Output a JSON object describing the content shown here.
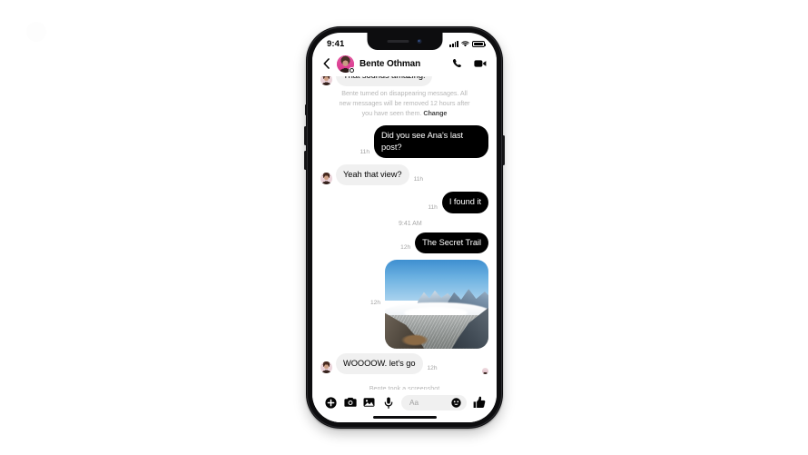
{
  "status_bar": {
    "time": "9:41",
    "signal_icon": "cellular-bars-icon",
    "wifi_icon": "wifi-icon",
    "battery_icon": "battery-full-icon"
  },
  "header": {
    "back_icon": "chevron-left-icon",
    "avatar_name": "avatar",
    "contact_name": "Bente Othman",
    "active_badge": "active-status-badge",
    "call_icon": "phone-call-icon",
    "video_icon": "video-camera-icon"
  },
  "conversation": {
    "clipped_message": {
      "text": "That sounds amazing!",
      "direction": "in"
    },
    "notice": {
      "text_before": "Bente turned on disappearing messages. All new messages will be removed 12 hours after you have seen them. ",
      "link": "Change"
    },
    "messages": [
      {
        "text": "Did you see Ana's last post?",
        "direction": "out",
        "time": "11h"
      },
      {
        "text": "Yeah that view?",
        "direction": "in",
        "time": "11h"
      },
      {
        "text": "I found it",
        "direction": "out",
        "time": "11h"
      }
    ],
    "time_divider": "9:41 AM",
    "link_message": {
      "text": "The Secret Trail",
      "direction": "out",
      "time": "12h"
    },
    "photo_message": {
      "direction": "out",
      "time": "12h",
      "alt": "snow-capped mountain valley with glacier"
    },
    "last_message": {
      "text": "WOOOOW. let's go",
      "direction": "in",
      "time": "12h"
    },
    "system_line": "Bente took a screenshot"
  },
  "composer": {
    "plus_icon": "plus-circle-icon",
    "camera_icon": "camera-icon",
    "gallery_icon": "photo-gallery-icon",
    "mic_icon": "microphone-icon",
    "input_placeholder": "Aa",
    "emoji_icon": "smiley-face-icon",
    "thumb_icon": "thumbs-up-icon"
  },
  "colors": {
    "outgoing_bubble": "#000000",
    "incoming_bubble": "#f0f0f0",
    "avatar_accent": "#e2579f",
    "muted_text": "#b7b7b7"
  }
}
